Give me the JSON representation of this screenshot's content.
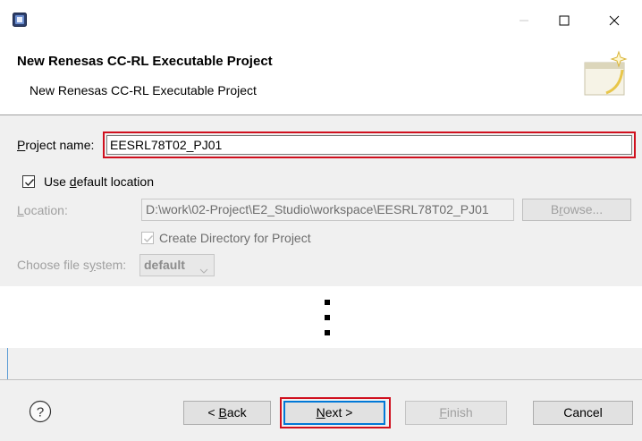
{
  "window": {
    "app_icon": "eclipse-app-icon",
    "minimize_icon": "minimize-icon",
    "maximize_icon": "maximize-icon",
    "close_icon": "close-icon"
  },
  "header": {
    "title": "New Renesas CC-RL Executable Project",
    "description": "New Renesas CC-RL Executable Project",
    "banner_icon": "new-project-wizard-icon"
  },
  "form": {
    "project_name": {
      "label_first": "P",
      "label_rest": "roject name:",
      "value": "EESRL78T02_PJ01"
    },
    "use_default_location": {
      "label_prefix": "Use ",
      "label_mnemonic": "d",
      "label_suffix": "efault location",
      "checked": true
    },
    "location": {
      "label_first": "L",
      "label_rest": "ocation:",
      "value": "D:\\work\\02-Project\\E2_Studio\\workspace\\EESRL78T02_PJ01"
    },
    "browse_button": {
      "label_prefix": "B",
      "label_mnemonic": "r",
      "label_suffix": "owse..."
    },
    "create_directory": {
      "label": "Create Directory for Project",
      "checked": true
    },
    "file_system": {
      "label_prefix": "Choose file s",
      "label_mnemonic": "y",
      "label_suffix": "stem:",
      "value": "default"
    }
  },
  "footer": {
    "help_icon": "help-icon",
    "back_button": {
      "label_prefix": "< ",
      "label_mnemonic": "B",
      "label_suffix": "ack"
    },
    "next_button": {
      "label_mnemonic": "N",
      "label_suffix": "ext >"
    },
    "finish_button": {
      "label_mnemonic": "F",
      "label_suffix": "inish"
    },
    "cancel_button": {
      "label": "Cancel"
    }
  },
  "colors": {
    "highlight_red": "#d0101e",
    "dialog_gray": "#f0f0f0",
    "default_button_blue": "#0078d7"
  }
}
